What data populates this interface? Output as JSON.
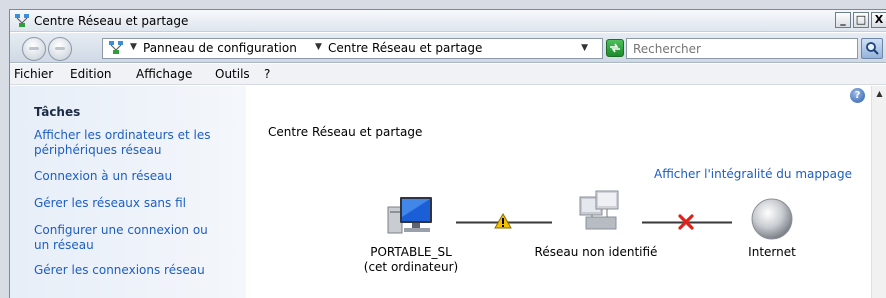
{
  "window": {
    "title": "Centre Réseau et partage",
    "controls": {
      "minimize": "_",
      "maximize": "□",
      "close": "X"
    }
  },
  "address_bar": {
    "breadcrumbs": [
      "Panneau de configuration",
      "Centre Réseau et partage"
    ],
    "search_placeholder": "Rechercher"
  },
  "menu": {
    "items": [
      "Fichier",
      "Edition",
      "Affichage",
      "Outils",
      "?"
    ]
  },
  "sidebar": {
    "heading": "Tâches",
    "links": [
      "Afficher les ordinateurs et les périphériques réseau",
      "Connexion à un réseau",
      "Gérer les réseaux sans fil",
      "Configurer une connexion ou un réseau",
      "Gérer les connexions réseau"
    ]
  },
  "main": {
    "title": "Centre Réseau et partage",
    "full_map_link": "Afficher l'intégralité du mappage",
    "help_label": "?",
    "network_map": {
      "computer_name": "PORTABLE_SL",
      "computer_sub": "(cet ordinateur)",
      "network_name": "Réseau non identifié",
      "internet_name": "Internet",
      "link1_status": "warning",
      "link2_status": "disconnected"
    }
  },
  "colors": {
    "link": "#1d5ec2",
    "warning": "#f2c200",
    "error": "#e0201b",
    "sidebar_bg": "#e7eef8"
  }
}
